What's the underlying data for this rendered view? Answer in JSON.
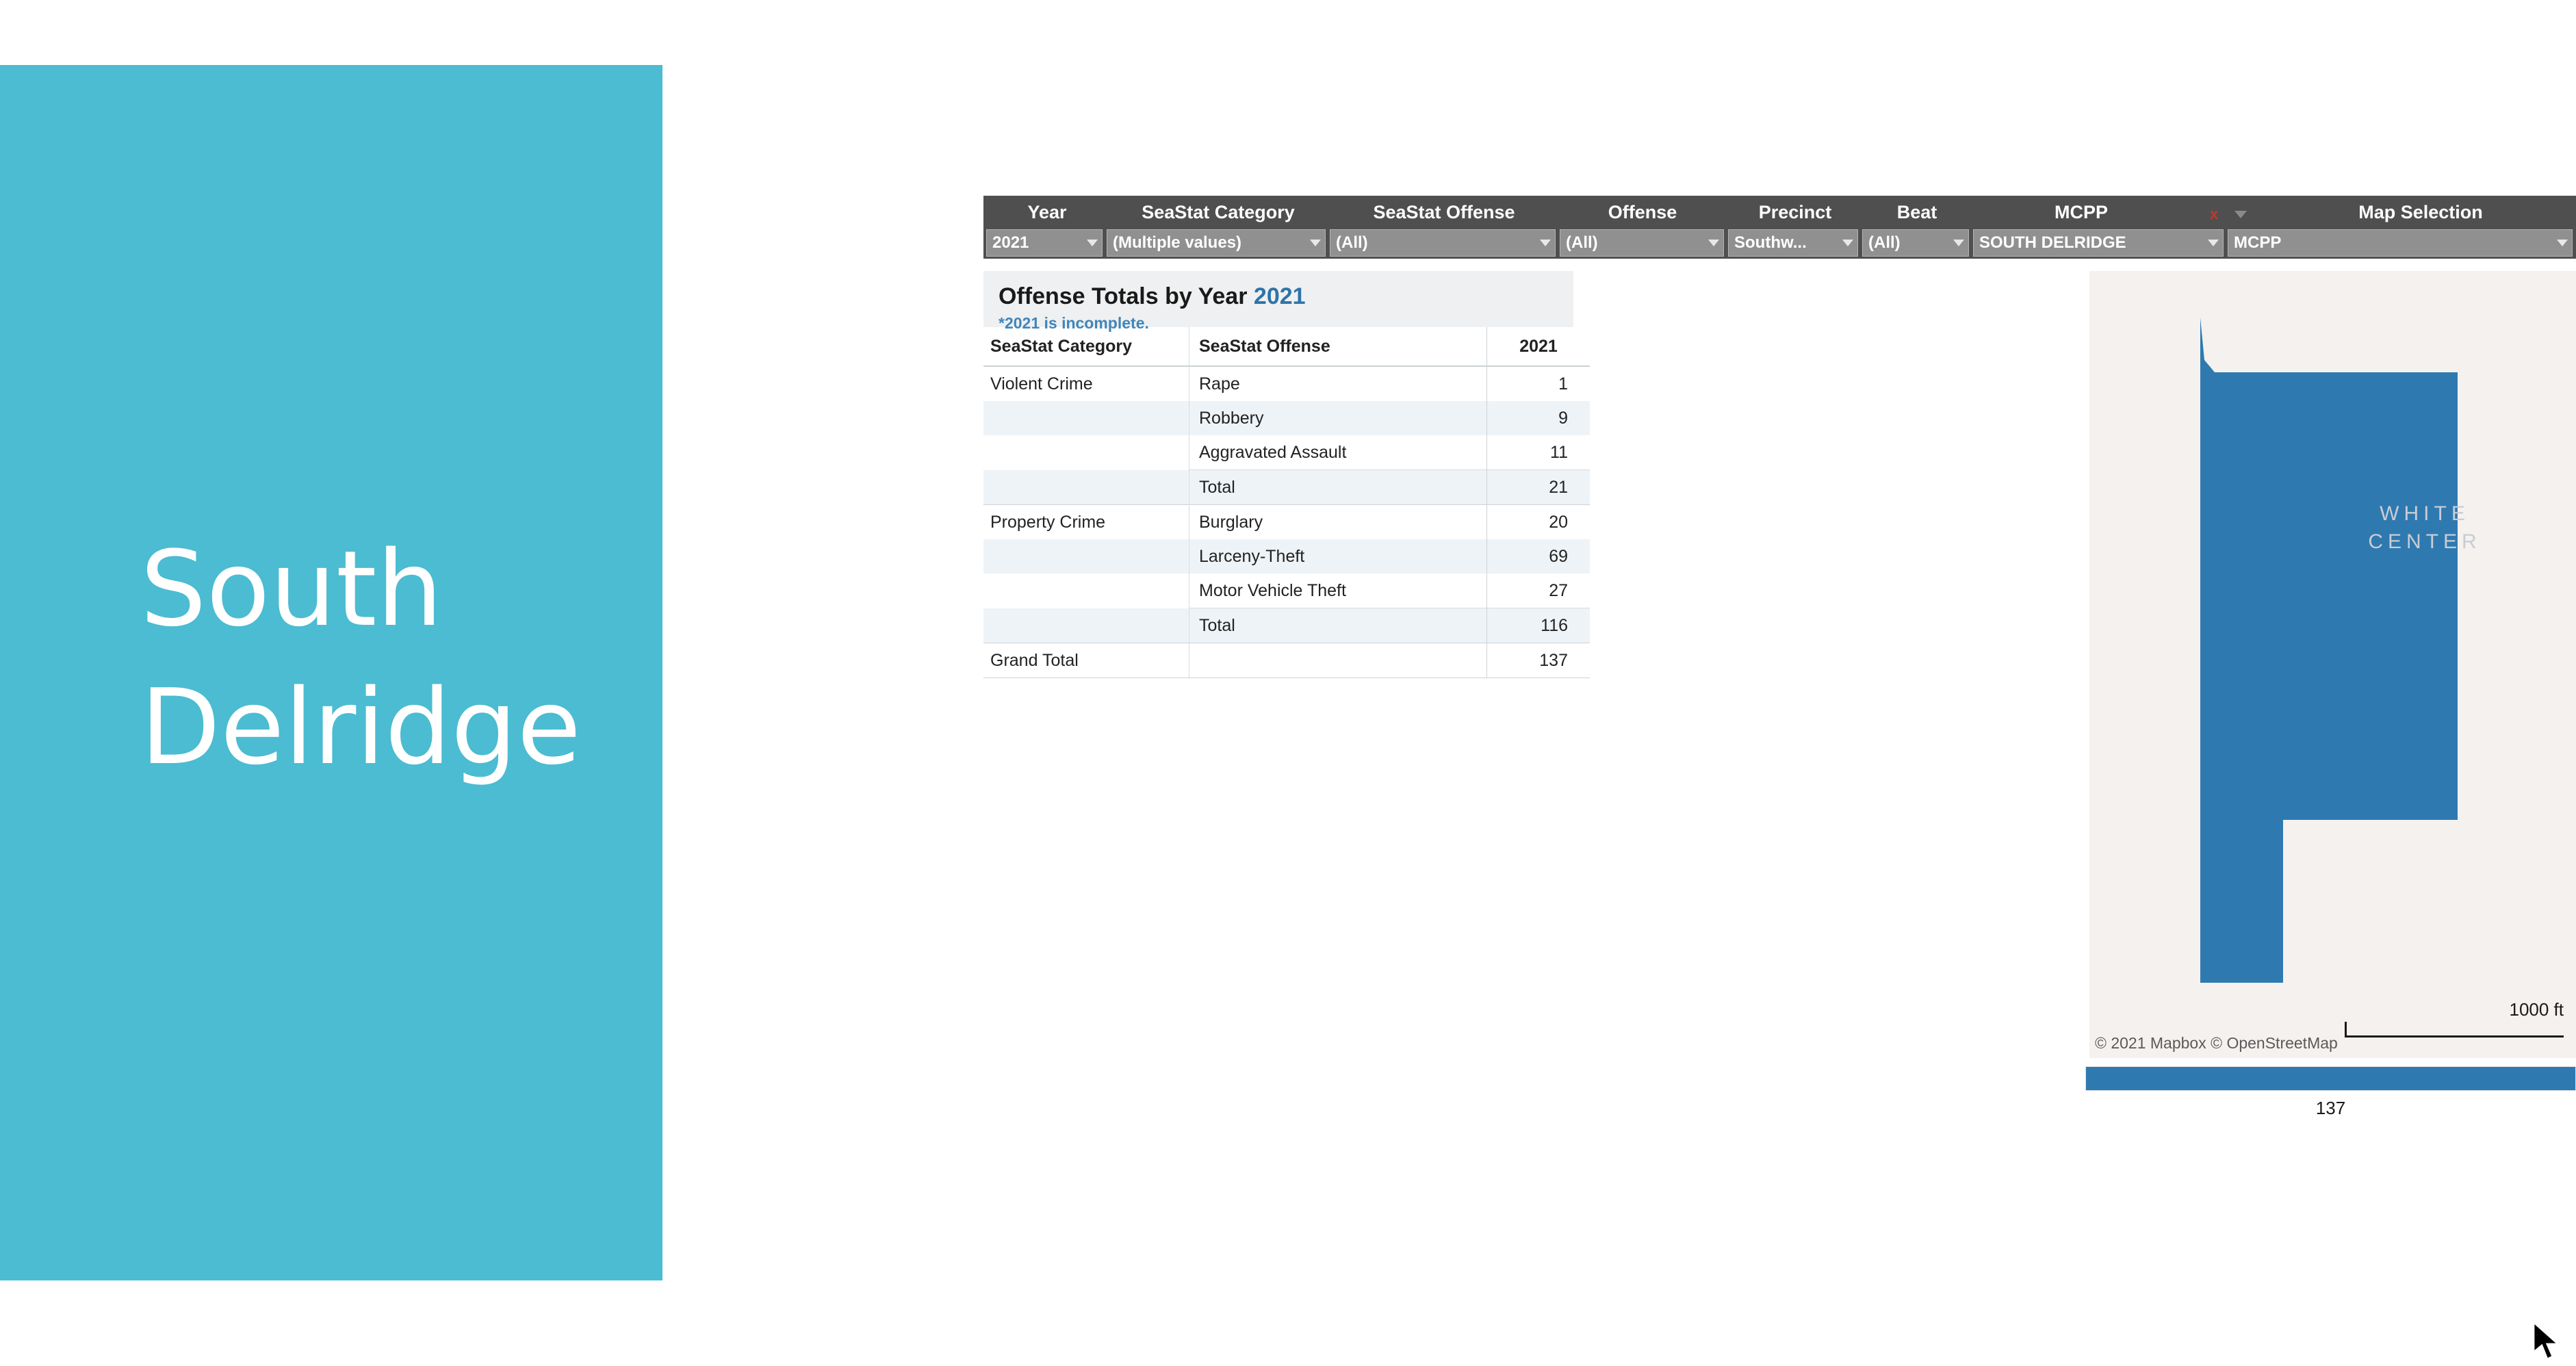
{
  "title_panel": {
    "line1": "South",
    "line2": "Delridge",
    "background_color": "#4bbcd1"
  },
  "filters": {
    "items": [
      {
        "label": "Year",
        "value": "2021",
        "name": "year"
      },
      {
        "label": "SeaStat Category",
        "value": "(Multiple values)",
        "name": "seastat-category"
      },
      {
        "label": "SeaStat Offense",
        "value": "(All)",
        "name": "seastat-offense"
      },
      {
        "label": "Offense",
        "value": "(All)",
        "name": "offense"
      },
      {
        "label": "Precinct",
        "value": "Southw...",
        "name": "precinct"
      },
      {
        "label": "Beat",
        "value": "(All)",
        "name": "beat"
      },
      {
        "label": "MCPP",
        "value": "SOUTH DELRIDGE",
        "name": "mcpp"
      },
      {
        "label": "Map Selection",
        "value": "MCPP",
        "name": "map-selection"
      }
    ],
    "clear_filter_glyph": "x"
  },
  "crosstab": {
    "title_main": "Offense Totals by Year",
    "title_year": "2021",
    "note": "*2021 is incomplete.",
    "columns": [
      "SeaStat Category",
      "SeaStat Offense",
      "2021"
    ],
    "rows": [
      {
        "category": "Violent Crime",
        "offense": "Rape",
        "value": "1",
        "band": false,
        "subtotal": false,
        "group_start": false
      },
      {
        "category": "",
        "offense": "Robbery",
        "value": "9",
        "band": true,
        "subtotal": false,
        "group_start": false
      },
      {
        "category": "",
        "offense": "Aggravated Assault",
        "value": "11",
        "band": false,
        "subtotal": false,
        "group_start": false
      },
      {
        "category": "",
        "offense": "Total",
        "value": "21",
        "band": true,
        "subtotal": true,
        "group_start": false
      },
      {
        "category": "Property Crime",
        "offense": "Burglary",
        "value": "20",
        "band": false,
        "subtotal": false,
        "group_start": true
      },
      {
        "category": "",
        "offense": "Larceny-Theft",
        "value": "69",
        "band": true,
        "subtotal": false,
        "group_start": false
      },
      {
        "category": "",
        "offense": "Motor Vehicle Theft",
        "value": "27",
        "band": false,
        "subtotal": false,
        "group_start": false
      },
      {
        "category": "",
        "offense": "Total",
        "value": "116",
        "band": true,
        "subtotal": true,
        "group_start": false
      }
    ],
    "grand_total": {
      "label": "Grand Total",
      "offense": "",
      "value": "137"
    },
    "value_color": "#2e74a8"
  },
  "map": {
    "region_label": "WHITE CENTER",
    "attribution": "© 2021 Mapbox  © OpenStreetMap",
    "scale_label": "1000 ft",
    "polygon_color": "#2e7ab0",
    "background_color": "#f4f1ef"
  },
  "chart_data": {
    "type": "bar",
    "title": "",
    "orientation": "horizontal",
    "categories": [
      "SOUTH DELRIDGE"
    ],
    "values": [
      137
    ],
    "labels": [
      "137"
    ],
    "value_color": "#2e7ab0",
    "xlabel": "",
    "ylabel": "",
    "xlim": [
      0,
      137
    ],
    "grid": false,
    "legend": false
  }
}
